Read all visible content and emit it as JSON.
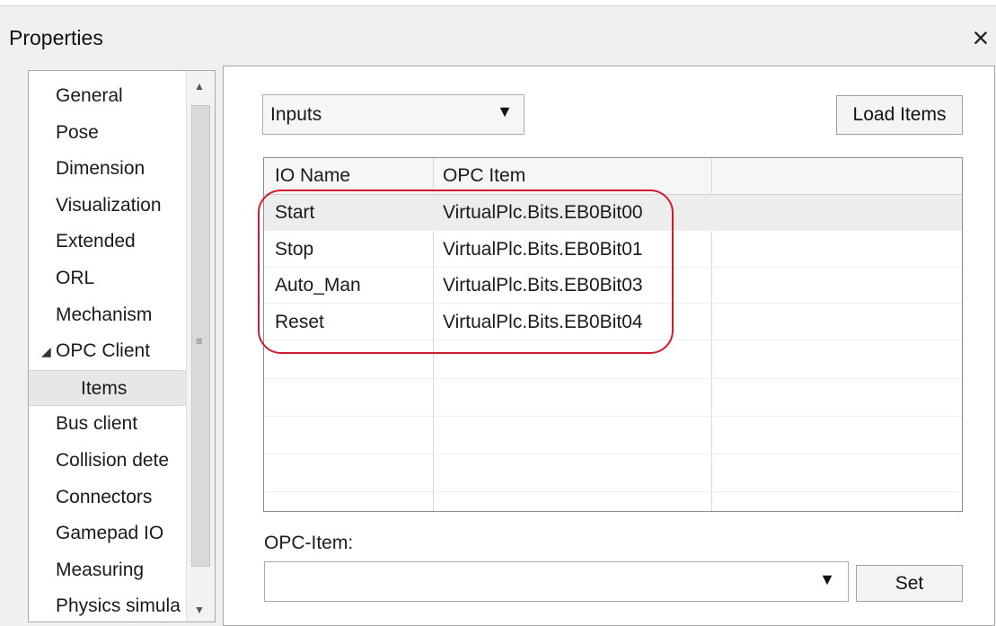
{
  "window": {
    "title": "Properties",
    "close_icon": "×"
  },
  "sidebar": {
    "items": [
      {
        "label": "General",
        "selected": false,
        "child": false
      },
      {
        "label": "Pose",
        "selected": false,
        "child": false
      },
      {
        "label": "Dimension",
        "selected": false,
        "child": false
      },
      {
        "label": "Visualization",
        "selected": false,
        "child": false
      },
      {
        "label": "Extended",
        "selected": false,
        "child": false
      },
      {
        "label": "ORL",
        "selected": false,
        "child": false
      },
      {
        "label": "Mechanism",
        "selected": false,
        "child": false
      },
      {
        "label": "OPC Client",
        "selected": false,
        "child": false,
        "expanded": true
      },
      {
        "label": "Items",
        "selected": true,
        "child": true
      },
      {
        "label": "Bus client",
        "selected": false,
        "child": false
      },
      {
        "label": "Collision dete",
        "selected": false,
        "child": false
      },
      {
        "label": "Connectors",
        "selected": false,
        "child": false
      },
      {
        "label": "Gamepad IO",
        "selected": false,
        "child": false
      },
      {
        "label": "Measuring",
        "selected": false,
        "child": false
      },
      {
        "label": "Physics simula",
        "selected": false,
        "child": false
      }
    ]
  },
  "content": {
    "dropdown": {
      "value": "Inputs"
    },
    "load_button": "Load Items",
    "table": {
      "columns": [
        "IO Name",
        "OPC Item"
      ],
      "rows": [
        {
          "io_name": "Start",
          "opc_item": "VirtualPlc.Bits.EB0Bit00"
        },
        {
          "io_name": "Stop",
          "opc_item": "VirtualPlc.Bits.EB0Bit01"
        },
        {
          "io_name": "Auto_Man",
          "opc_item": "VirtualPlc.Bits.EB0Bit03"
        },
        {
          "io_name": "Reset",
          "opc_item": "VirtualPlc.Bits.EB0Bit04"
        }
      ]
    },
    "opc_item_label": "OPC-Item:",
    "opc_item_value": "",
    "set_button": "Set"
  },
  "colors": {
    "highlight": "#d21c2f",
    "selection": "#e7e7e7"
  }
}
